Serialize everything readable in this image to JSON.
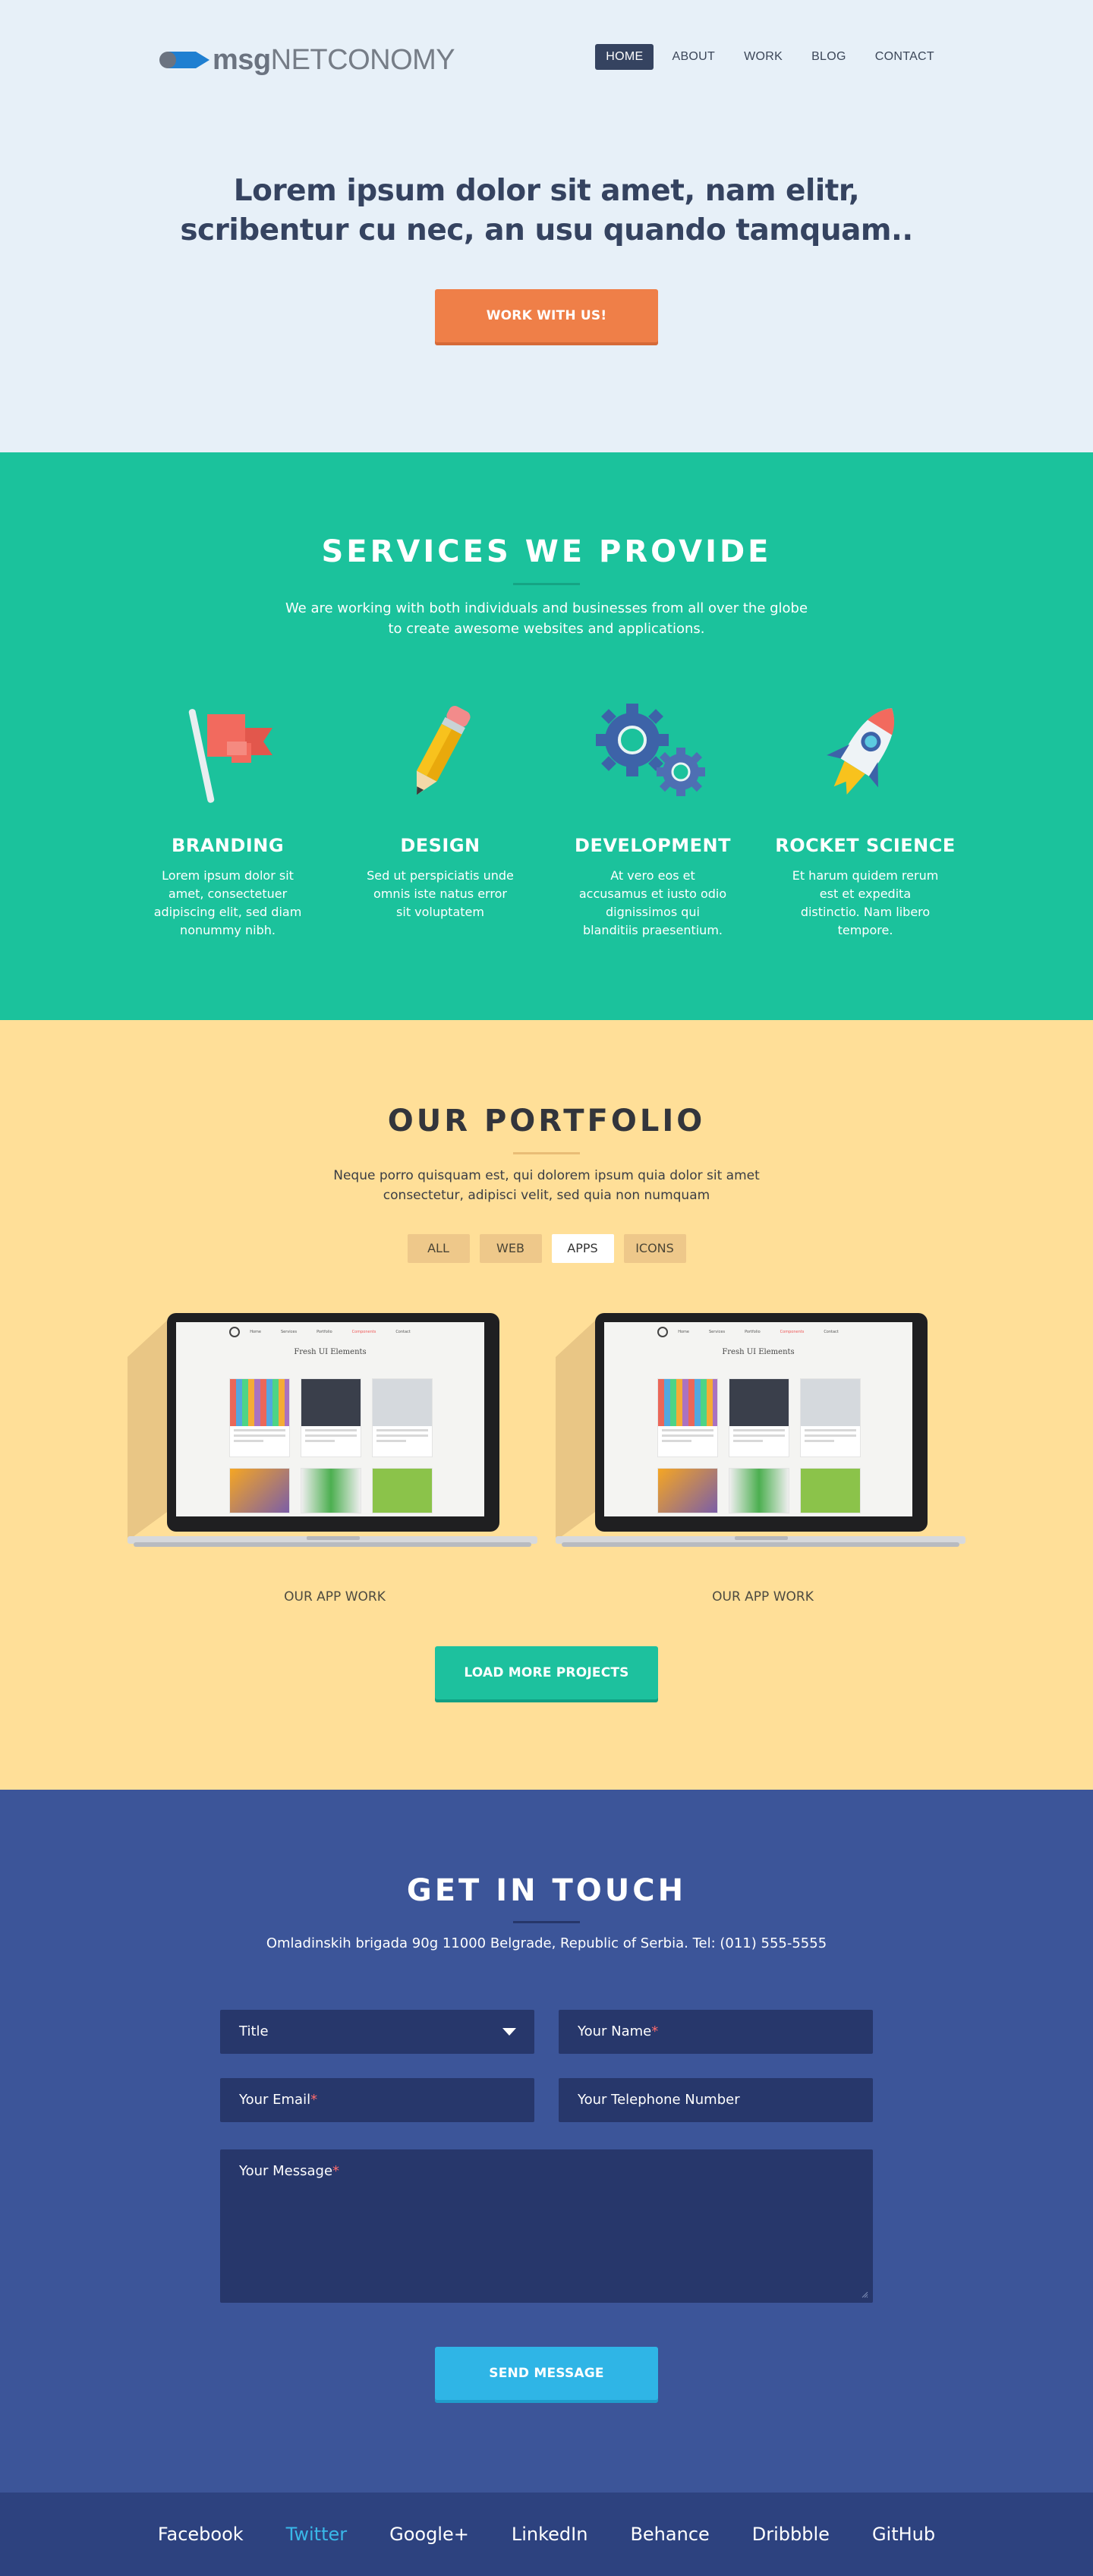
{
  "brand": {
    "logo_bold": "msg",
    "logo_light": "NETCONOMY"
  },
  "nav": [
    {
      "label": "HOME",
      "active": true
    },
    {
      "label": "ABOUT",
      "active": false
    },
    {
      "label": "WORK",
      "active": false
    },
    {
      "label": "BLOG",
      "active": false
    },
    {
      "label": "CONTACT",
      "active": false
    }
  ],
  "hero": {
    "title_line1": "Lorem ipsum dolor sit amet, nam elitr,",
    "title_line2": "scribentur cu nec, an usu quando tamquam..",
    "cta": "WORK WITH US!"
  },
  "services": {
    "title": "SERVICES WE PROVIDE",
    "lead_line1": "We are working with both individuals and businesses from all over the globe",
    "lead_line2": "to create awesome websites and applications.",
    "items": [
      {
        "title": "BRANDING",
        "icon": "flag-icon",
        "text": "Lorem ipsum dolor sit amet, consectetuer adipiscing elit, sed diam nonummy nibh."
      },
      {
        "title": "DESIGN",
        "icon": "pencil-icon",
        "text": "Sed ut perspiciatis unde omnis iste natus error sit voluptatem"
      },
      {
        "title": "DEVELOPMENT",
        "icon": "gears-icon",
        "text": "At vero eos et accusamus et iusto odio dignissimos qui blanditiis praesentium."
      },
      {
        "title": "ROCKET SCIENCE",
        "icon": "rocket-icon",
        "text": "Et harum quidem rerum est et expedita distinctio. Nam libero tempore."
      }
    ]
  },
  "portfolio": {
    "title": "OUR PORTFOLIO",
    "lead_line1": "Neque porro quisquam est, qui dolorem ipsum quia dolor sit amet",
    "lead_line2": "consectetur, adipisci velit, sed quia non numquam",
    "filters": [
      {
        "label": "ALL",
        "active": false
      },
      {
        "label": "WEB",
        "active": false
      },
      {
        "label": "APPS",
        "active": true
      },
      {
        "label": "ICONS",
        "active": false
      }
    ],
    "projects": [
      {
        "caption": "OUR APP WORK",
        "screen_title": "Fresh UI Elements"
      },
      {
        "caption": "OUR APP WORK",
        "screen_title": "Fresh UI Elements"
      }
    ],
    "load_more": "LOAD MORE PROJECTS"
  },
  "contact": {
    "title": "GET IN TOUCH",
    "address": "Omladinskih brigada 90g 11000 Belgrade, Republic of Serbia. Tel: (011) 555-5555",
    "fields": {
      "title_select": "Title",
      "name": "Your Name",
      "email": "Your Email",
      "phone": "Your Telephone Number",
      "message": "Your Message",
      "required_mark": "*"
    },
    "submit": "SEND MESSAGE"
  },
  "footer": {
    "links": [
      {
        "label": "Facebook",
        "active": false
      },
      {
        "label": "Twitter",
        "active": true
      },
      {
        "label": "Google+",
        "active": false
      },
      {
        "label": "LinkedIn",
        "active": false
      },
      {
        "label": "Behance",
        "active": false
      },
      {
        "label": "Dribbble",
        "active": false
      },
      {
        "label": "GitHub",
        "active": false
      }
    ]
  },
  "colors": {
    "hero_bg": "#e7f0f8",
    "services_bg": "#1bc29c",
    "portfolio_bg": "#ffdf98",
    "contact_bg": "#3c5599",
    "footer_bg": "#2d427f",
    "accent_orange": "#ef7f48",
    "accent_teal": "#1dc19e",
    "accent_blue": "#2fb5e6"
  }
}
